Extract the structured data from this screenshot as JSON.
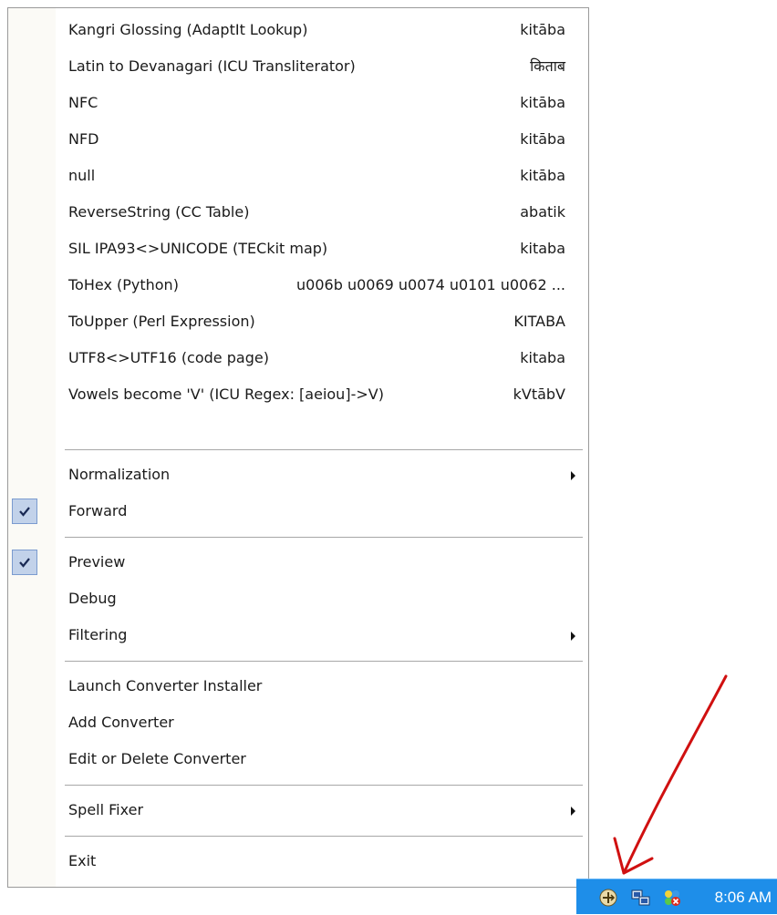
{
  "menu": {
    "converters": [
      {
        "label": "Kangri Glossing (AdaptIt Lookup)",
        "result": "kitāba"
      },
      {
        "label": "Latin to Devanagari (ICU Transliterator)",
        "result": "किताब"
      },
      {
        "label": "NFC",
        "result": "kitāba"
      },
      {
        "label": "NFD",
        "result": "kitāba"
      },
      {
        "label": "null",
        "result": "kitāba"
      },
      {
        "label": "ReverseString (CC Table)",
        "result": "abatik"
      },
      {
        "label": "SIL IPA93<>UNICODE (TECkit map)",
        "result": "kitaba"
      },
      {
        "label": "ToHex (Python)",
        "result": "u006b u0069 u0074 u0101 u0062 ..."
      },
      {
        "label": "ToUpper (Perl Expression)",
        "result": "KITABA"
      },
      {
        "label": "UTF8<>UTF16 (code page)",
        "result": "kitaba"
      },
      {
        "label": "Vowels become 'V' (ICU Regex: [aeiou]->V)",
        "result": "kVtābV"
      }
    ],
    "normalization": "Normalization",
    "forward": "Forward",
    "preview": "Preview",
    "debug": "Debug",
    "filtering": "Filtering",
    "launch_installer": "Launch Converter Installer",
    "add_converter": "Add Converter",
    "edit_delete_converter": "Edit or Delete Converter",
    "spell_fixer": "Spell Fixer",
    "exit": "Exit"
  },
  "checked": {
    "forward": true,
    "preview": true
  },
  "taskbar": {
    "clock": "8:06 AM"
  },
  "colors": {
    "taskbar": "#1e8ee9",
    "check_bg": "#c2d2ea",
    "annotation_arrow": "#d01010"
  },
  "icons": [
    "check-icon",
    "submenu-arrow-icon",
    "converter-tray-icon",
    "network-tray-icon",
    "security-alert-tray-icon"
  ]
}
